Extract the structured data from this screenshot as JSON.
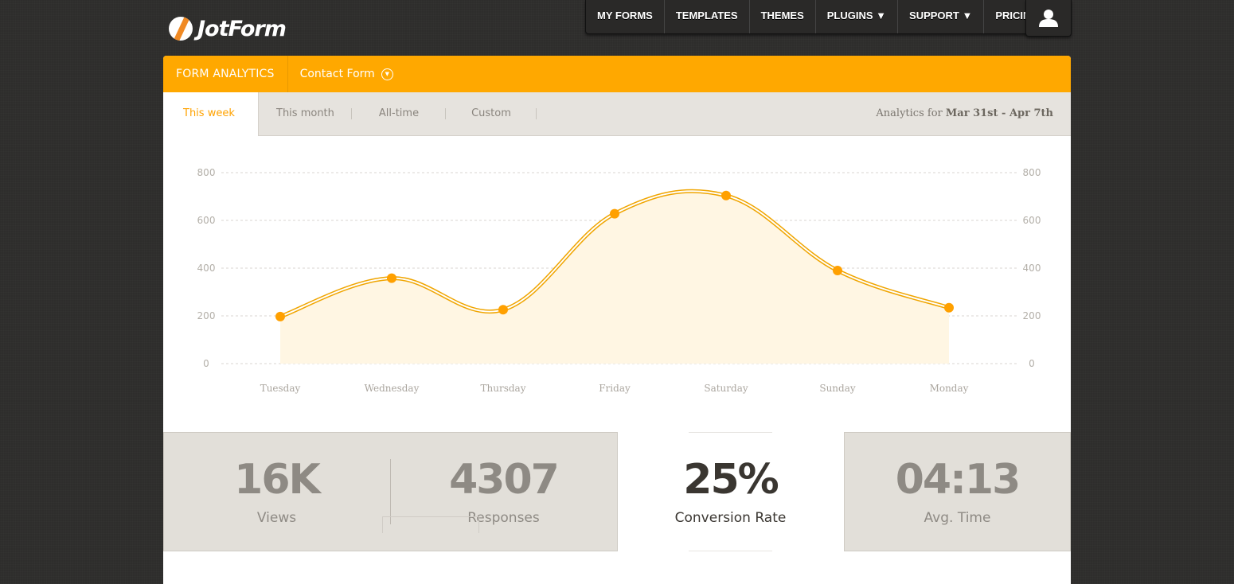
{
  "brand": {
    "name": "JotForm"
  },
  "topnav": {
    "items": [
      {
        "label": "MY FORMS"
      },
      {
        "label": "TEMPLATES"
      },
      {
        "label": "THEMES"
      },
      {
        "label": "PLUGINS ▼"
      },
      {
        "label": "SUPPORT ▼"
      },
      {
        "label": "PRICING"
      }
    ],
    "user_icon": "user-icon"
  },
  "header": {
    "title": "FORM ANALYTICS",
    "form_name": "Contact Form",
    "form_chevron_icon": "chevron-down-circle-icon"
  },
  "tabs": [
    {
      "label": "This week",
      "active": true
    },
    {
      "label": "This month",
      "active": false
    },
    {
      "label": "All-time",
      "active": false
    },
    {
      "label": "Custom",
      "active": false
    }
  ],
  "range": {
    "prefix": "Analytics for",
    "value": "Mar 31st - Apr 7th"
  },
  "colors": {
    "accent": "#ffa800",
    "area_fill": "#fff6e3",
    "line": "#f0a500"
  },
  "chart_data": {
    "type": "area",
    "categories": [
      "Tuesday",
      "Wednesday",
      "Thursday",
      "Friday",
      "Saturday",
      "Sunday",
      "Monday"
    ],
    "series": [
      {
        "values": [
          197,
          358,
          226,
          628,
          704,
          390,
          234
        ]
      }
    ],
    "y_ticks": [
      0,
      200,
      400,
      600,
      800
    ],
    "ylim": [
      0,
      800
    ],
    "grid": true,
    "dual_axis_labels": true
  },
  "stats": [
    {
      "value": "16K",
      "label": "Views"
    },
    {
      "value": "4307",
      "label": "Responses"
    },
    {
      "value": "25%",
      "label": "Conversion Rate"
    },
    {
      "value": "04:13",
      "label": "Avg. Time"
    }
  ]
}
